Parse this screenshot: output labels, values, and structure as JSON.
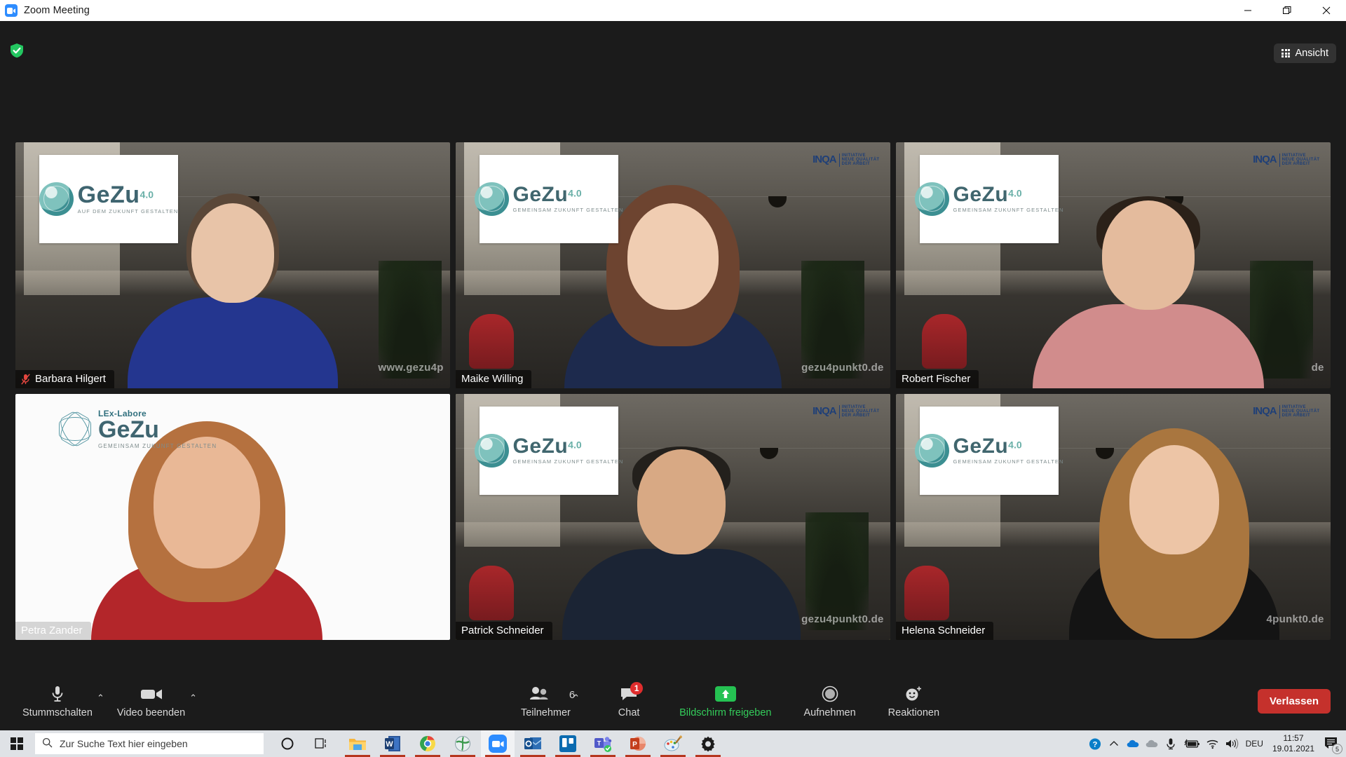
{
  "window": {
    "title": "Zoom Meeting",
    "icon": "zoom-video-icon",
    "minimize": "—",
    "maximize": "❐",
    "close": "✕"
  },
  "topbar": {
    "encryption_icon": "green-shield-check-icon",
    "view_button": {
      "label": "Ansicht",
      "icon": "grid-view-icon"
    }
  },
  "branding": {
    "gezu_main": "GeZu",
    "gezu_sup": "4.0",
    "gezu_sub": "GEMEINSAM ZUKUNFT GESTALTEN",
    "gezu_sub_alt": "AUF DEM ZUKUNFT GESTALTEN",
    "lex_title": "LEx-Labore",
    "inqa_mark": "INQA",
    "inqa_line1": "INITIATIVE",
    "inqa_line2": "NEUE QUALITÄT",
    "inqa_line3": "DER ARBEIT",
    "watermark": "gezu4punkt0.de",
    "watermark_alt": "www.gezu4p"
  },
  "participants": [
    {
      "name": "Barbara Hilgert",
      "muted": true,
      "active": false,
      "label_style": "dark",
      "background": "office",
      "logo": "gezu-alt",
      "watermark": "www.gezu4p"
    },
    {
      "name": "Maike Willing",
      "muted": false,
      "active": false,
      "label_style": "dark",
      "background": "office",
      "logo": "gezu",
      "watermark": "gezu4punkt0.de"
    },
    {
      "name": "Robert Fischer",
      "muted": false,
      "active": false,
      "label_style": "dark",
      "background": "office",
      "logo": "gezu",
      "watermark": "de"
    },
    {
      "name": "Petra Zander",
      "muted": false,
      "active": false,
      "label_style": "light",
      "background": "white",
      "logo": "lex",
      "watermark": ""
    },
    {
      "name": "Patrick Schneider",
      "muted": false,
      "active": true,
      "label_style": "dark",
      "background": "office",
      "logo": "gezu",
      "watermark": "gezu4punkt0.de"
    },
    {
      "name": "Helena Schneider",
      "muted": false,
      "active": false,
      "label_style": "dark",
      "background": "office",
      "logo": "gezu",
      "watermark": "4punkt0.de"
    }
  ],
  "toolbar": {
    "mute": {
      "label": "Stummschalten",
      "icon": "microphone-icon",
      "caret": "⌃"
    },
    "video": {
      "label": "Video beenden",
      "icon": "video-camera-icon",
      "caret": "⌃"
    },
    "participants": {
      "label": "Teilnehmer",
      "icon": "people-icon",
      "count": "6",
      "caret": "⌃"
    },
    "chat": {
      "label": "Chat",
      "icon": "chat-bubble-icon",
      "badge": "1"
    },
    "share": {
      "label": "Bildschirm freigeben",
      "icon": "share-screen-up-arrow-icon"
    },
    "record": {
      "label": "Aufnehmen",
      "icon": "record-circle-icon"
    },
    "reactions": {
      "label": "Reaktionen",
      "icon": "smiley-plus-icon"
    },
    "leave": {
      "label": "Verlassen"
    }
  },
  "taskbar": {
    "start_icon": "windows-start-icon",
    "search_placeholder": "Zur Suche Text hier eingeben",
    "search_icon": "search-icon",
    "apps": [
      {
        "name": "cortana-icon"
      },
      {
        "name": "task-view-icon"
      },
      {
        "name": "file-explorer-icon"
      },
      {
        "name": "word-icon"
      },
      {
        "name": "chrome-icon"
      },
      {
        "name": "internet-browser-icon"
      },
      {
        "name": "zoom-icon"
      },
      {
        "name": "outlook-icon"
      },
      {
        "name": "trello-icon"
      },
      {
        "name": "teams-icon"
      },
      {
        "name": "powerpoint-icon"
      },
      {
        "name": "paint-icon"
      },
      {
        "name": "settings-gear-icon"
      }
    ],
    "tray": {
      "help_icon": "help-circle-icon",
      "chevron_icon": "chevron-up-icon",
      "onedrive_blue_icon": "onedrive-blue-icon",
      "onedrive_gray_icon": "onedrive-gray-icon",
      "mic_icon": "microphone-icon",
      "battery_icon": "battery-charging-icon",
      "wifi_icon": "wifi-icon",
      "speaker_icon": "speaker-icon",
      "language": "DEU",
      "time": "11:57",
      "date": "19.01.2021",
      "notification_icon": "action-center-icon",
      "notification_count": "5"
    }
  },
  "colors": {
    "accent_green": "#33cc5a",
    "leave_red": "#c5312c",
    "active_border": "#e9f28a",
    "badge_red": "#e02d2d",
    "zoom_blue": "#2d8cff"
  }
}
